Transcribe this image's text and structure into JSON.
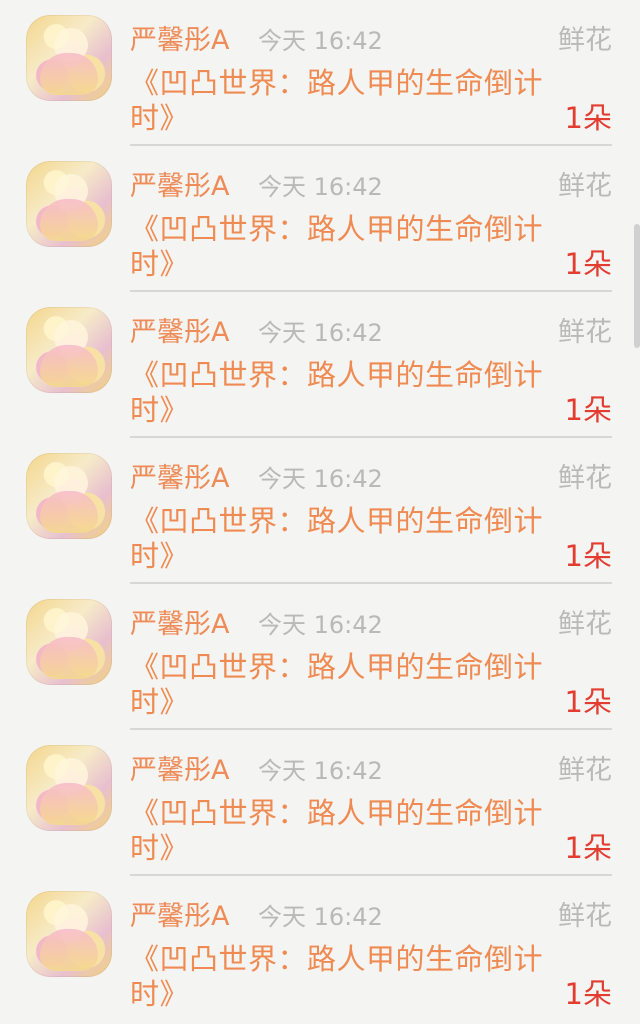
{
  "notifications": [
    {
      "user": "严馨彤A",
      "time": "今天 16:42",
      "gift_type": "鲜花",
      "title": "《凹凸世界：路人甲的生命倒计时》",
      "count": "1朵"
    },
    {
      "user": "严馨彤A",
      "time": "今天 16:42",
      "gift_type": "鲜花",
      "title": "《凹凸世界：路人甲的生命倒计时》",
      "count": "1朵"
    },
    {
      "user": "严馨彤A",
      "time": "今天 16:42",
      "gift_type": "鲜花",
      "title": "《凹凸世界：路人甲的生命倒计时》",
      "count": "1朵"
    },
    {
      "user": "严馨彤A",
      "time": "今天 16:42",
      "gift_type": "鲜花",
      "title": "《凹凸世界：路人甲的生命倒计时》",
      "count": "1朵"
    },
    {
      "user": "严馨彤A",
      "time": "今天 16:42",
      "gift_type": "鲜花",
      "title": "《凹凸世界：路人甲的生命倒计时》",
      "count": "1朵"
    },
    {
      "user": "严馨彤A",
      "time": "今天 16:42",
      "gift_type": "鲜花",
      "title": "《凹凸世界：路人甲的生命倒计时》",
      "count": "1朵"
    },
    {
      "user": "严馨彤A",
      "time": "今天 16:42",
      "gift_type": "鲜花",
      "title": "《凹凸世界：路人甲的生命倒计时》",
      "count": "1朵"
    }
  ],
  "colors": {
    "background": "#f4f4f2",
    "name": "#ee8b57",
    "title": "#ef8b52",
    "meta": "#b9b9b9",
    "count": "#e33d31",
    "divider": "#d7d7d7"
  }
}
